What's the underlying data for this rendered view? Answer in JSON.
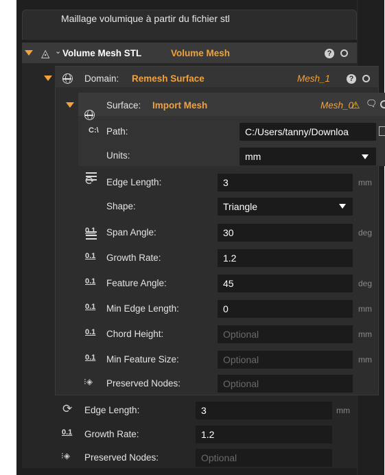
{
  "header": {
    "title": "Maillage volumique à partir du fichier stl"
  },
  "level1": {
    "name": "Volume Mesh STL",
    "type": "Volume Mesh",
    "rows": [
      {
        "label": "Edge Length:",
        "value": "3",
        "unit": "mm",
        "icon": "edge-length-icon"
      },
      {
        "label": "Growth Rate:",
        "value": "1.2",
        "unit": "",
        "icon": "numeric-icon"
      },
      {
        "label": "Preserved Nodes:",
        "placeholder": "Optional",
        "icon": "nodes-icon"
      }
    ]
  },
  "level2": {
    "label": "Domain:",
    "type": "Remesh Surface",
    "id": "Mesh_1",
    "rows": [
      {
        "label": "Edge Length:",
        "value": "3",
        "unit": "mm"
      },
      {
        "label": "Shape:",
        "value": "Triangle"
      },
      {
        "label": "Span Angle:",
        "value": "30",
        "unit": "deg"
      },
      {
        "label": "Growth Rate:",
        "value": "1.2",
        "unit": ""
      },
      {
        "label": "Feature Angle:",
        "value": "45",
        "unit": "deg"
      },
      {
        "label": "Min Edge Length:",
        "value": "0",
        "unit": "mm"
      },
      {
        "label": "Chord Height:",
        "placeholder": "Optional",
        "unit": "mm"
      },
      {
        "label": "Min Feature Size:",
        "placeholder": "Optional",
        "unit": "mm"
      },
      {
        "label": "Preserved Nodes:",
        "placeholder": "Optional"
      }
    ]
  },
  "level3": {
    "label": "Surface:",
    "type": "Import Mesh",
    "id": "Mesh_0",
    "path_label": "Path:",
    "path_prefix": "C:\\",
    "path_value": "C:/Users/tanny/Downloa",
    "units_label": "Units:",
    "units_value": "mm"
  },
  "icons": {
    "numeric": "0.1"
  },
  "colors": {
    "accent": "#f2a23c",
    "background": "#1f1f1f",
    "field": "#1b1b1b"
  }
}
